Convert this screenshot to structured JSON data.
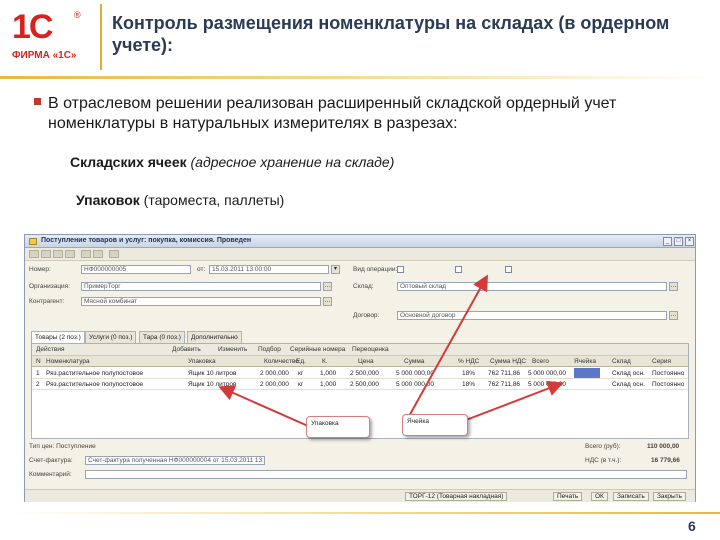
{
  "logo": {
    "mark": "1С",
    "reg": "®",
    "firma": "ФИРМА «1С»"
  },
  "title": "Контроль размещения номенклатуры на складах (в ордерном учете):",
  "bullet": "В отраслевом решении реализован расширенный складской ордерный учет номенклатуры в натуральных измерителях в разрезах:",
  "sub1": {
    "bold": "Складских ячеек",
    "italic": "(адресное хранение на складе)"
  },
  "sub2": {
    "bold": "Упаковок",
    "normal": "(тароместа, паллеты)"
  },
  "window": {
    "title": "Поступление товаров и услуг: покупка, комиссия. Проведен",
    "controls": [
      "_",
      "□",
      "×"
    ],
    "fields": {
      "nomer_label": "Номер:",
      "nomer_value": "НФ000000005",
      "ot_label": "от:",
      "ot_value": "15.03.2011 13:00:00",
      "organizaciya_label": "Организация:",
      "organizaciya_value": "ПримерТорг",
      "kontragent_label": "Контрагент:",
      "kontragent_value": "Мясной комбинат",
      "sklad_label": "Склад:",
      "sklad_value": "Оптовый склад",
      "dogovor_label": "Договор:",
      "dogovor_value": "Основной договор",
      "vid_label": "Вид операции:",
      "vid_value": "Покупка, комиссия"
    },
    "tabs": [
      "Товары (2 поз.)",
      "Услуги (0 поз.)",
      "Тара (0 поз.)",
      "Дополнительно"
    ],
    "grid_toolbar": [
      "Действия",
      "Добавить",
      "Изменить",
      "Подбор",
      "Серийные номера",
      "Переоценка"
    ],
    "columns": [
      "N",
      "Номенклатура",
      "Упаковка",
      "Количество",
      "Ед.",
      "К.",
      "Цена",
      "Сумма",
      "% НДС",
      "Сумма НДС",
      "Всего",
      "Ячейка",
      "Склад",
      "Серия"
    ],
    "rows": [
      [
        "1",
        "Ряз.растительное полупостовое",
        "Ящик 10 литров",
        "2 000,000",
        "кг",
        "1,000",
        "2 500,000",
        "5 000 000,00",
        "18%",
        "762 711,86",
        "5 000 000,00",
        "",
        "Склад осн.",
        "Постоянно"
      ],
      [
        "2",
        "Ряз.растительное полупостовое",
        "Ящик 10 литров",
        "2 000,000",
        "кг",
        "1,000",
        "2 500,000",
        "5 000 000,00",
        "18%",
        "762 711,86",
        "5 000 000,00",
        "",
        "Склад осн.",
        "Постоянно"
      ]
    ],
    "footer": {
      "tip_cen_label": "Тип цен: Поступление",
      "schet_label": "Счет-фактура:",
      "schet_value": "Счет-фактура полученная НФ000000004 от 15.03.2011 13:00:00",
      "comment_label": "Комментарий:",
      "vsego_label": "Всего (руб):",
      "vsego_value": "110 000,00",
      "nds_label": "НДС (в т.ч.):",
      "nds_value": "16 779,66"
    },
    "status": [
      "ТОРГ-12 (Товарная накладная)",
      "Печать",
      "ОК",
      "Записать",
      "Закрыть"
    ]
  },
  "callouts": {
    "upakovka": "Упаковка",
    "yacheyka": "Ячейка"
  },
  "page_number": "6"
}
